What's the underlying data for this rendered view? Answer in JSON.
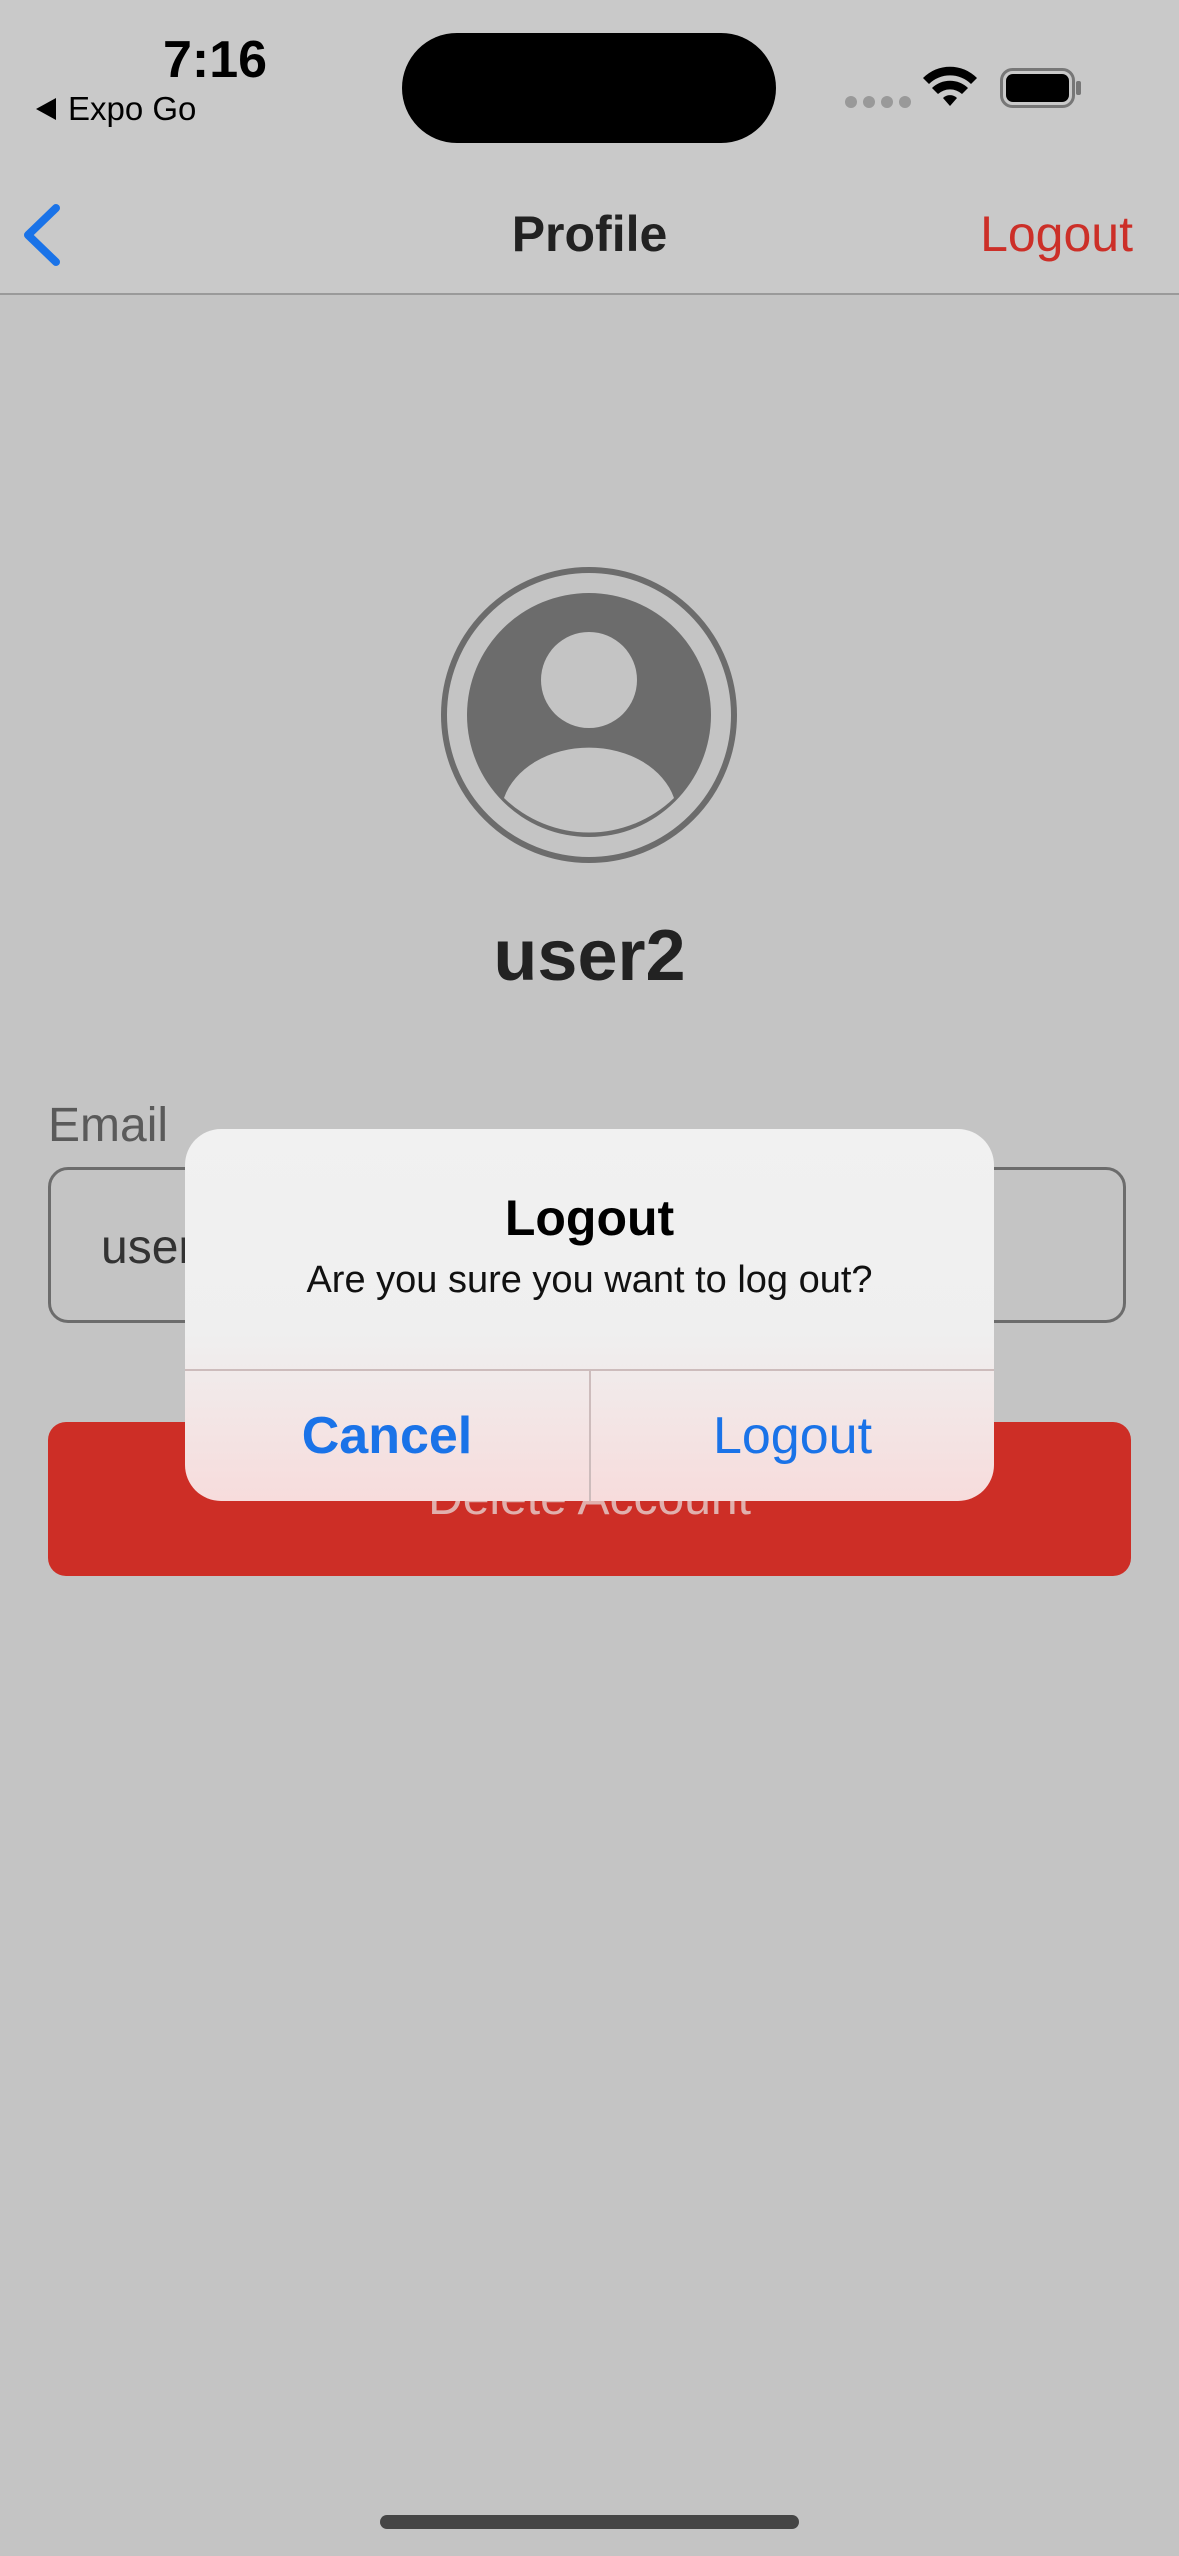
{
  "status_bar": {
    "time": "7:16",
    "back_app_label": "Expo Go"
  },
  "nav": {
    "title": "Profile",
    "logout_label": "Logout"
  },
  "profile": {
    "username": "user2",
    "email_label": "Email",
    "email_value_visible": "user",
    "delete_label": "Delete Account"
  },
  "alert": {
    "title": "Logout",
    "message": "Are you sure you want to log out?",
    "cancel_label": "Cancel",
    "confirm_label": "Logout"
  },
  "colors": {
    "accent_blue": "#1a73e8",
    "destructive_red": "#cd2e26",
    "background": "#c4c4c4"
  }
}
